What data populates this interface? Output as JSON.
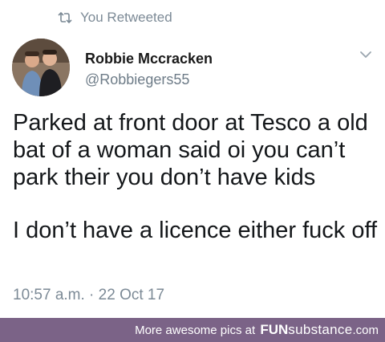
{
  "retweet": {
    "label": "You Retweeted",
    "icon": "retweet-icon"
  },
  "author": {
    "name": "Robbie Mccracken",
    "handle": "@Robbiegers55",
    "avatar_icon": "profile-photo"
  },
  "menu": {
    "icon": "chevron-down-icon"
  },
  "tweet": {
    "paragraphs": [
      "Parked at front door at Tesco a old bat of a woman said oi you can’t park their you don’t have kids",
      "I don’t have a licence either fuck off"
    ]
  },
  "timestamp": "10:57 a.m. · 22 Oct 17",
  "footer": {
    "prefix": "More awesome pics at",
    "brand_fun": "FUN",
    "brand_substance": "substance",
    "brand_tld": ".com",
    "background": "#7b6387"
  },
  "colors": {
    "text": "#14171a",
    "muted": "#7c8a96",
    "footer_bg": "#7b6387"
  }
}
